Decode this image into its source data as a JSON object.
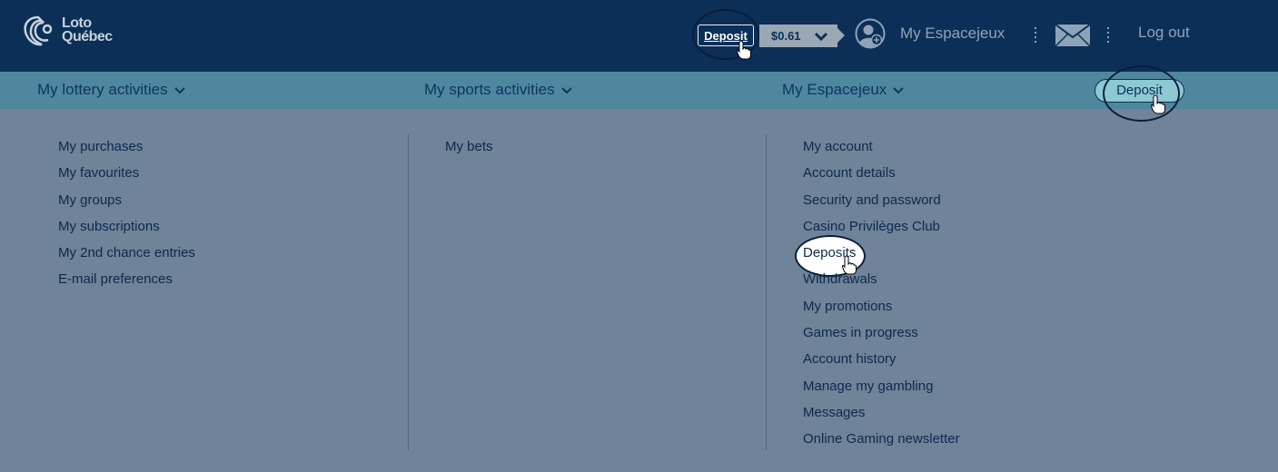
{
  "header": {
    "logo_line1": "Loto",
    "logo_line2": "Québec",
    "deposit_label": "Deposit",
    "balance": "$0.61",
    "my_espacejeux": "My Espacejeux",
    "logout": "Log out",
    "icons": [
      "logo-icon",
      "chevron-down-icon",
      "avatar-icon",
      "mail-icon",
      "hand-cursor-icon"
    ]
  },
  "nav": {
    "lottery": "My lottery activities",
    "sports": "My sports activities",
    "espacejeux": "My Espacejeux",
    "deposit_label": "Deposit"
  },
  "menu": {
    "lottery_items": [
      "My purchases",
      "My favourites",
      "My groups",
      "My subscriptions",
      "My 2nd chance entries",
      "E-mail preferences"
    ],
    "sports_items": [
      "My bets"
    ],
    "espacejeux_items": [
      "My account",
      "Account details",
      "Security and password",
      "Casino Privilèges Club",
      "Deposits",
      "Withdrawals",
      "My promotions",
      "Games in progress",
      "Account history",
      "Manage my gambling",
      "Messages",
      "Online Gaming newsletter"
    ]
  },
  "colors": {
    "header_bg": "#0b2f57",
    "nav_bg": "#4f879e",
    "menu_bg": "#6f8399",
    "deposit_nav_bg": "#8cc9d3"
  }
}
